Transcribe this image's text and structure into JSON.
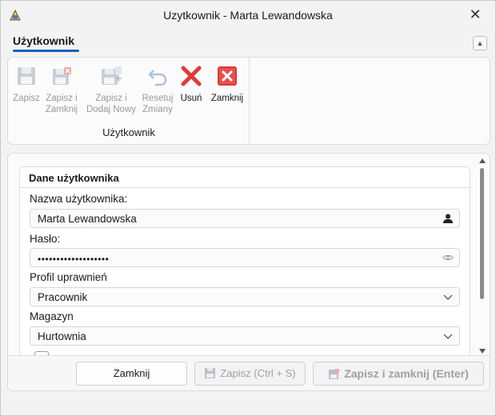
{
  "window": {
    "title": "Uzytkownik - Marta Lewandowska"
  },
  "ribbon": {
    "tab": "Użytkownik",
    "group_label": "Użytkownik",
    "buttons": {
      "save": {
        "line1": "Zapisz",
        "line2": ""
      },
      "save_close": {
        "line1": "Zapisz i",
        "line2": "Zamknij"
      },
      "save_add": {
        "line1": "Zapisz i",
        "line2": "Dodaj Nowy"
      },
      "reset": {
        "line1": "Resetuj",
        "line2": "Zmiany"
      },
      "delete": {
        "line1": "Usuń",
        "line2": ""
      },
      "close": {
        "line1": "Zamknij",
        "line2": ""
      }
    }
  },
  "panel": {
    "header": "Dane użytkownika",
    "username": {
      "label": "Nazwa użytkownika:",
      "value": "Marta Lewandowska"
    },
    "password": {
      "label": "Hasło:",
      "value": "•••••••••••••••••••"
    },
    "profile": {
      "label": "Profil uprawnień",
      "value": "Pracownik"
    },
    "warehouse": {
      "label": "Magazyn",
      "value": "Hurtownia"
    }
  },
  "footer": {
    "close": "Zamknij",
    "save": "Zapisz (Ctrl + S)",
    "save_close": "Zapisz i zamknij (Enter)"
  },
  "colors": {
    "accent": "#1a63b8",
    "danger": "#e03a3a"
  }
}
